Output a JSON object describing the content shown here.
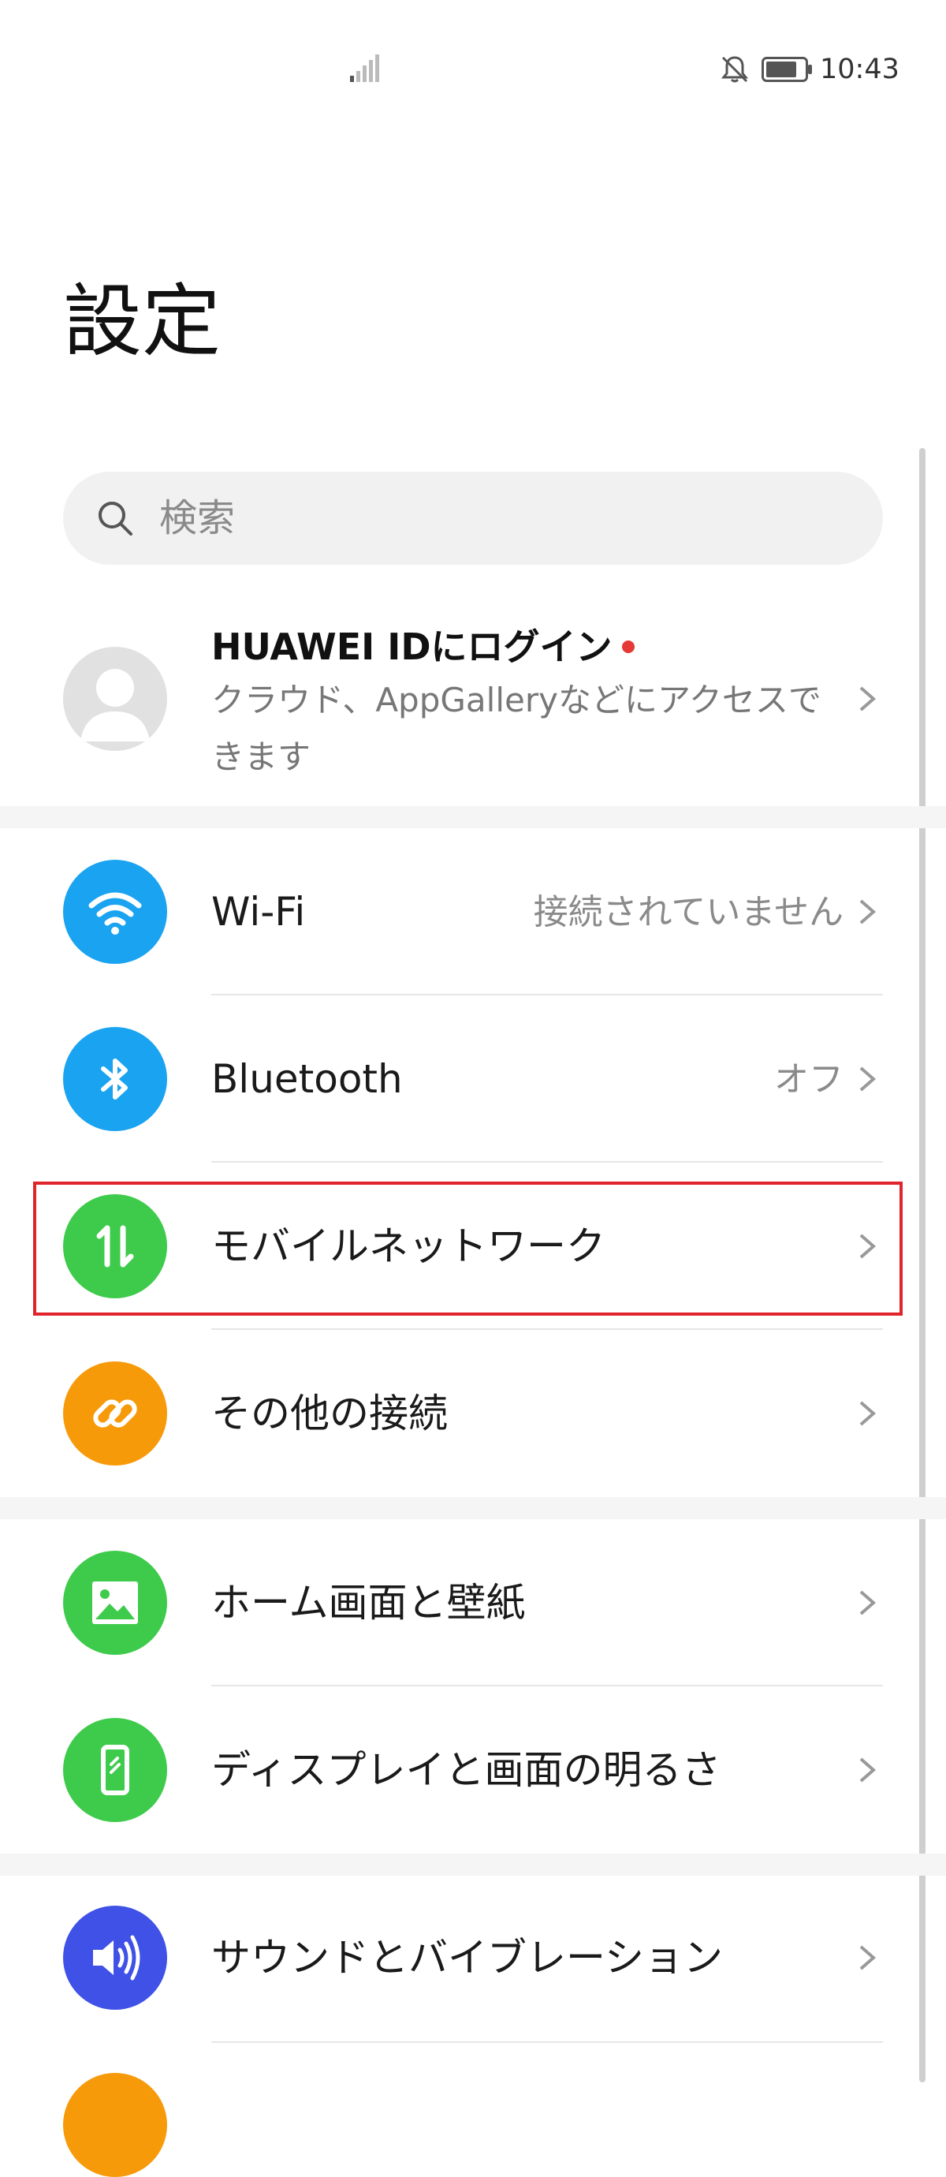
{
  "status_bar": {
    "time": "10:43",
    "icons": [
      "signal-icon",
      "bell-off-icon",
      "battery-icon"
    ]
  },
  "page": {
    "title": "設定"
  },
  "search": {
    "placeholder": "検索"
  },
  "account": {
    "title": "HUAWEI IDにログイン",
    "subtitle": "クラウド、AppGalleryなどにアクセスできます"
  },
  "settings": {
    "wifi": {
      "label": "Wi-Fi",
      "value": "接続されていません",
      "icon": "wifi-icon",
      "color": "#1aa3f0"
    },
    "bluetooth": {
      "label": "Bluetooth",
      "value": "オフ",
      "icon": "bluetooth-icon",
      "color": "#1aa3f0"
    },
    "mobile": {
      "label": "モバイルネットワーク",
      "icon": "mobile-data-icon",
      "color": "#3ecb4b"
    },
    "other": {
      "label": "その他の接続",
      "icon": "link-icon",
      "color": "#f79a0a"
    },
    "home": {
      "label": "ホーム画面と壁紙",
      "icon": "image-icon",
      "color": "#3ecb4b"
    },
    "display": {
      "label": "ディスプレイと画面の明るさ",
      "icon": "phone-brightness-icon",
      "color": "#3ecb4b"
    },
    "sound": {
      "label": "サウンドとバイブレーション",
      "icon": "speaker-icon",
      "color": "#3f51e6"
    }
  },
  "colors": {
    "accent_highlight": "#e0242c",
    "background": "#ffffff",
    "divider": "#e6e6e6"
  }
}
